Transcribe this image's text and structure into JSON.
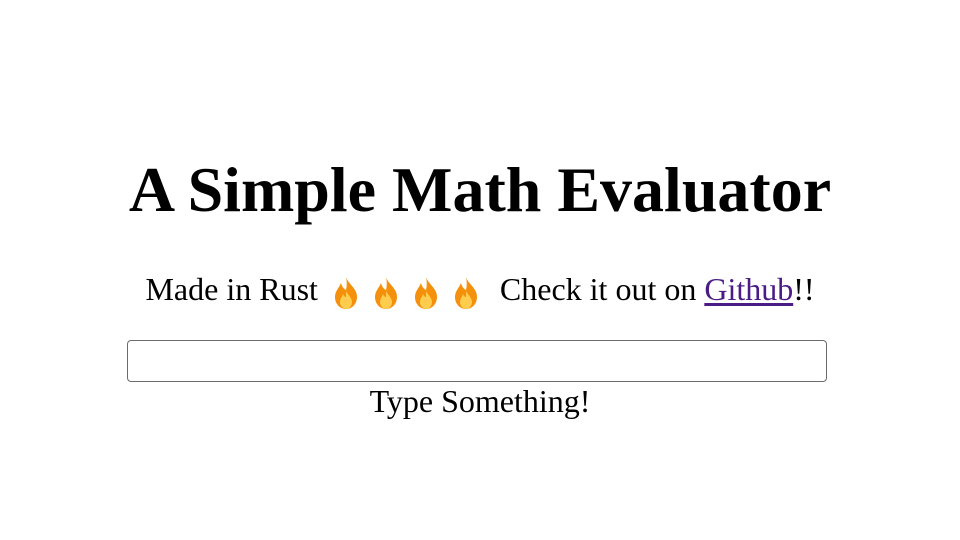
{
  "header": {
    "title": "A Simple Math Evaluator"
  },
  "subtitle": {
    "prefix": "Made in Rust",
    "fire_icon": "fire-icon",
    "fire_count": 4,
    "middle": "Check it out on",
    "link_text": "Github",
    "suffix": "!!",
    "link_color": "#4b1c86"
  },
  "input": {
    "value": "",
    "placeholder": ""
  },
  "output": {
    "text": "Type Something!"
  }
}
